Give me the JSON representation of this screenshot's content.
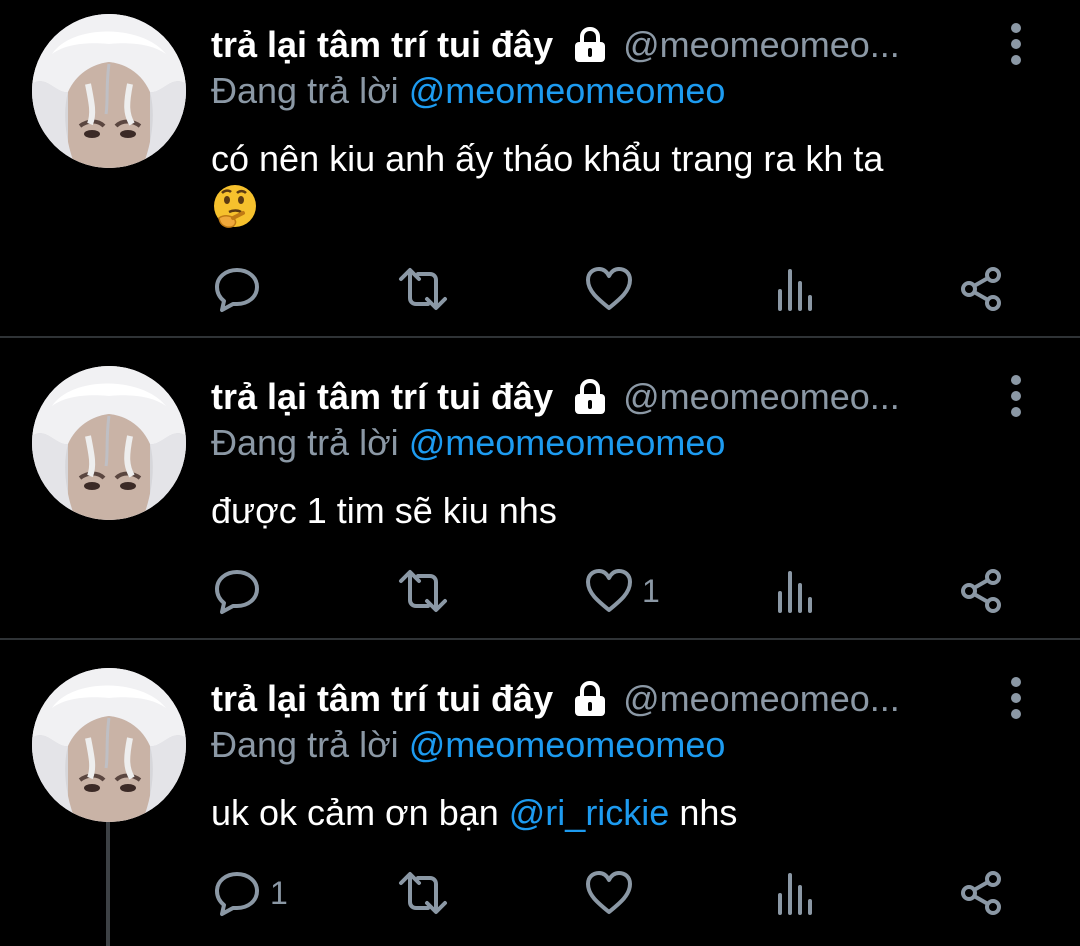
{
  "tweets": [
    {
      "display_name": "trả lại tâm trí tui đây",
      "handle": "@meomeomeo...",
      "replying_prefix": "Đang trả lời",
      "replying_to": "@meomeomeomeo",
      "text": "có nên kiu anh ấy tháo khẩu trang ra kh ta",
      "emoji": "thinking-face-emoji",
      "reply_count": "",
      "like_count": ""
    },
    {
      "display_name": "trả lại tâm trí tui đây",
      "handle": "@meomeomeo...",
      "replying_prefix": "Đang trả lời",
      "replying_to": "@meomeomeomeo",
      "text": "được 1 tim sẽ kiu nhs",
      "reply_count": "",
      "like_count": "1"
    },
    {
      "display_name": "trả lại tâm trí tui đây",
      "handle": "@meomeomeo...",
      "replying_prefix": "Đang trả lời",
      "replying_to": "@meomeomeomeo",
      "text_prefix": "uk ok cảm ơn bạn ",
      "text_mention": "@ri_rickie",
      "text_suffix": " nhs",
      "reply_count": "1",
      "like_count": ""
    }
  ],
  "colors": {
    "background": "#000000",
    "text": "#ffffff",
    "secondary": "#8b98a5",
    "accent": "#1d9bf0",
    "divider": "#2f3336",
    "icon": "#8b98a5"
  },
  "icons": [
    "lock-icon",
    "more-icon",
    "reply-icon",
    "retweet-icon",
    "like-icon",
    "views-icon",
    "share-icon"
  ]
}
